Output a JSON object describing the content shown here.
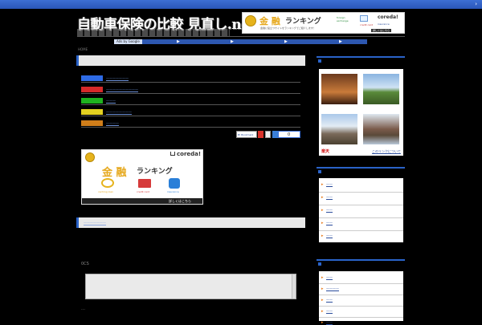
{
  "site": {
    "title": "自動車保険の比較 見直し.net",
    "top_arrow": "›"
  },
  "top_banner": {
    "brand": "coreda!",
    "headline_big": "金 融",
    "headline": "ランキング",
    "sub": "金融に役立つサイトをランキングでご紹介します！",
    "tags": [
      "foreign exchange",
      "insurance",
      "credit card"
    ],
    "cta": "詳しくはこちら"
  },
  "ads": {
    "label": "Ads by Google",
    "links": [
      "▶",
      "▶",
      "▶",
      "▶",
      "▶"
    ]
  },
  "breadcrumb": "HOME",
  "link_rows": [
    {
      "color": "#2e6be6",
      "text": "———————"
    },
    {
      "color": "#d62a2a",
      "text": "——————————"
    },
    {
      "color": "#1fb21f",
      "text": "———"
    },
    {
      "color": "#e3d021",
      "text": "————————"
    },
    {
      "color": "#d07e1a",
      "text": "————"
    }
  ],
  "share": {
    "bookmark": "B! Bookmark",
    "count": "0"
  },
  "big_ad": {
    "brand": "coreda!",
    "headline_big": "金 融",
    "headline": "ランキング",
    "items": [
      "caching loan",
      "credit card",
      "insurance"
    ],
    "cta": "詳しくはこちら"
  },
  "post": {
    "title": "———————",
    "comments_label": "0CS",
    "trackback_label": "…"
  },
  "sidebar": {
    "photo_footer_left": "楽天",
    "photo_footer_right": "このリンクについて",
    "list1": [
      "——",
      "——",
      "——",
      "——",
      "——"
    ],
    "list2": [
      "——",
      "————",
      "——",
      "——",
      "——"
    ]
  },
  "colors": {
    "accent": "#2a63c9",
    "bullet": "#e87c1d",
    "coreda_gold": "#e6b31c"
  }
}
